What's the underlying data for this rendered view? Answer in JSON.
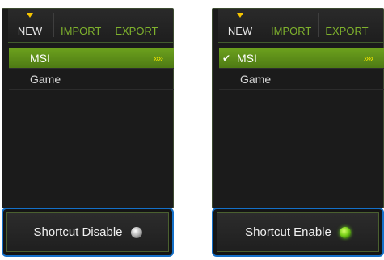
{
  "left": {
    "toolbar": {
      "new": "NEW",
      "import": "IMPORT",
      "export": "EXPORT"
    },
    "items": [
      {
        "label": "MSI",
        "selected": true,
        "checked": false,
        "chevron": "»»"
      },
      {
        "label": "Game",
        "selected": false,
        "checked": false
      }
    ],
    "shortcut": {
      "label": "Shortcut Disable",
      "state": "off"
    }
  },
  "right": {
    "toolbar": {
      "new": "NEW",
      "import": "IMPORT",
      "export": "EXPORT"
    },
    "items": [
      {
        "label": "MSI",
        "selected": true,
        "checked": true,
        "check_mark": "✔",
        "chevron": "»»"
      },
      {
        "label": "Game",
        "selected": false,
        "checked": false
      }
    ],
    "shortcut": {
      "label": "Shortcut Enable",
      "state": "on"
    }
  },
  "colors": {
    "accent_green": "#7fb22d",
    "selected_row": "#5e9119",
    "highlight_border": "#1470c8",
    "new_arrow": "#f5c400"
  }
}
